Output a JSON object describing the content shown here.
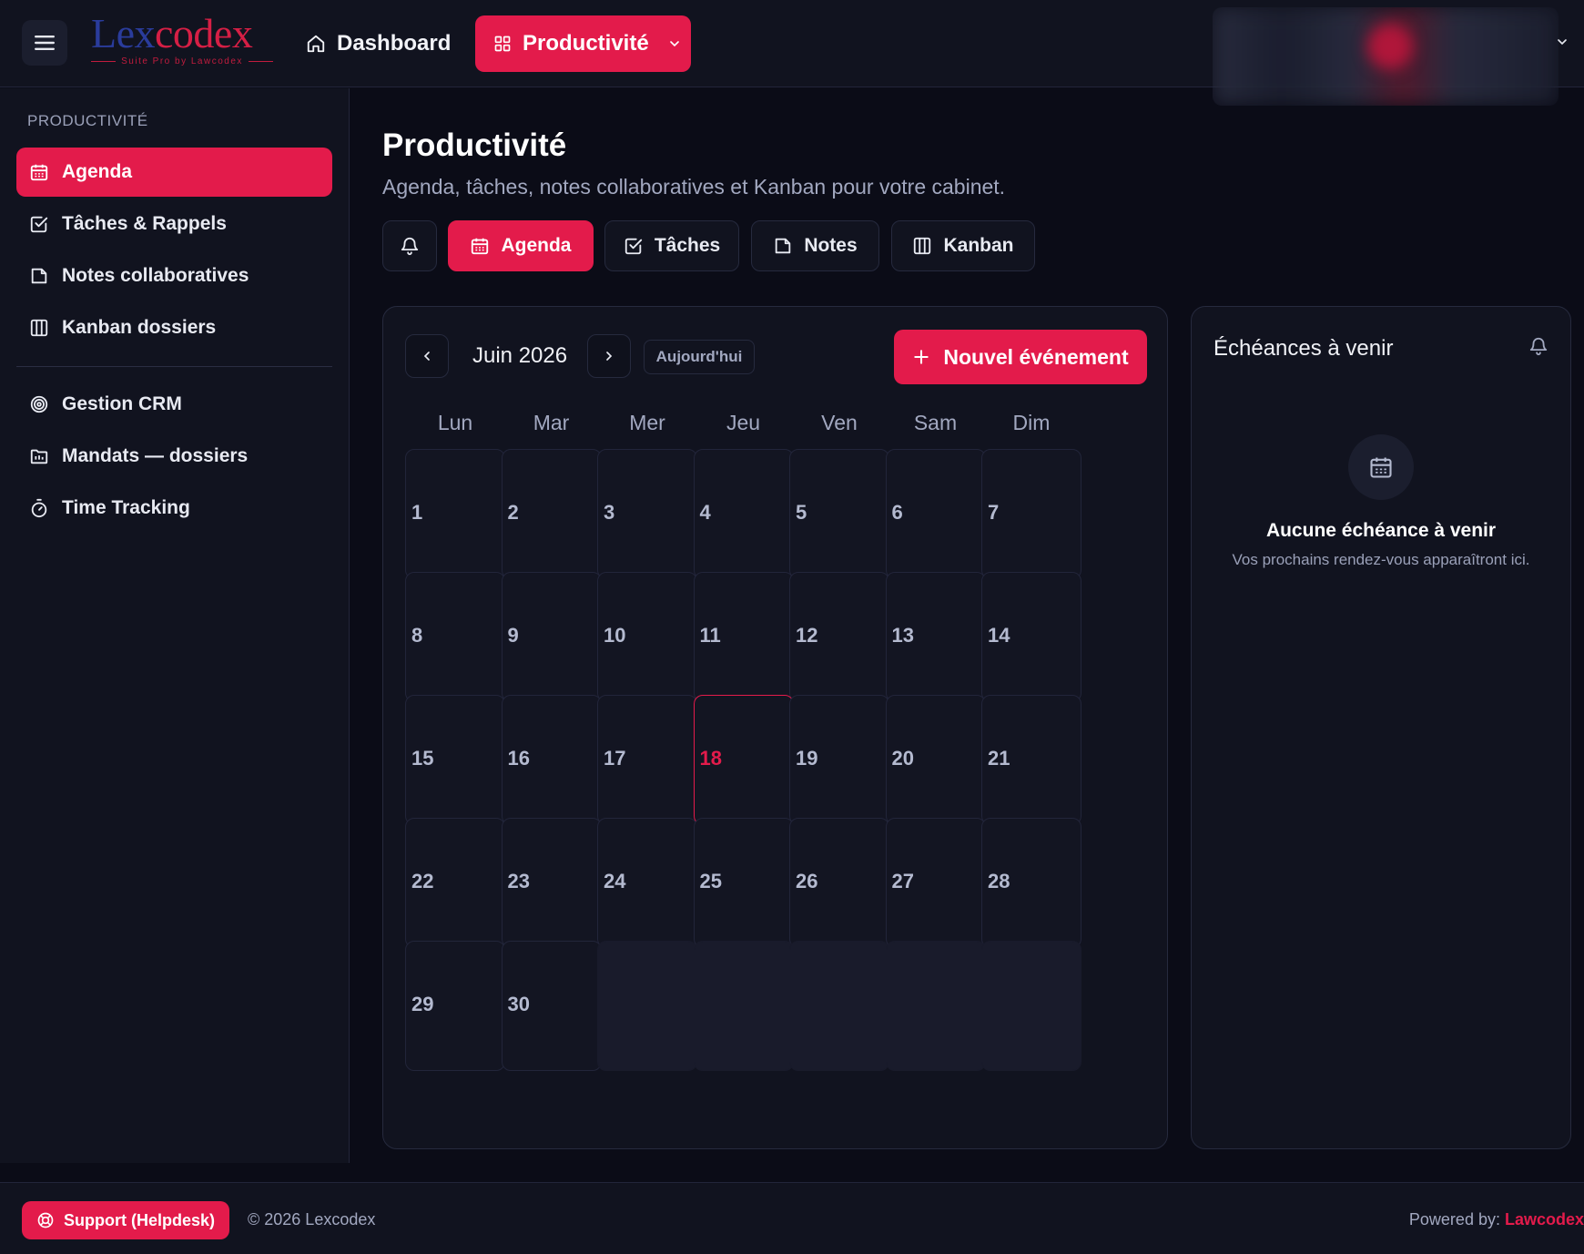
{
  "header": {
    "logo": {
      "text_main": "Lex",
      "text_accent": "codex",
      "tagline": "Suite Pro by Lawcodex"
    },
    "nav": [
      {
        "label": "Dashboard",
        "icon": "home-icon"
      },
      {
        "label": "Productivité",
        "icon": "grid-icon"
      }
    ]
  },
  "sidebar": {
    "section_title": "PRODUCTIVITÉ",
    "items": [
      {
        "label": "Agenda",
        "icon": "calendar-icon",
        "active": true
      },
      {
        "label": "Tâches & Rappels",
        "icon": "checkbox-icon"
      },
      {
        "label": "Notes collaboratives",
        "icon": "note-icon"
      },
      {
        "label": "Kanban dossiers",
        "icon": "columns-icon"
      },
      {
        "label": "Gestion CRM",
        "icon": "target-icon"
      },
      {
        "label": "Mandats — dossiers",
        "icon": "folder-icon"
      },
      {
        "label": "Time Tracking",
        "icon": "stopwatch-icon"
      }
    ]
  },
  "main": {
    "title": "Productivité",
    "subtitle": "Agenda, tâches, notes collaboratives et Kanban pour votre cabinet.",
    "tabs": [
      {
        "label": "Agenda",
        "icon": "calendar-icon",
        "active": true
      },
      {
        "label": "Tâches",
        "icon": "checkbox-icon"
      },
      {
        "label": "Notes",
        "icon": "note-icon"
      },
      {
        "label": "Kanban",
        "icon": "columns-icon"
      }
    ]
  },
  "calendar": {
    "month_label": "Juin 2026",
    "today_label": "Aujourd'hui",
    "new_event_label": "Nouvel événement",
    "weekdays": [
      "Lun",
      "Mar",
      "Mer",
      "Jeu",
      "Ven",
      "Sam",
      "Dim"
    ],
    "days": [
      1,
      2,
      3,
      4,
      5,
      6,
      7,
      8,
      9,
      10,
      11,
      12,
      13,
      14,
      15,
      16,
      17,
      18,
      19,
      20,
      21,
      22,
      23,
      24,
      25,
      26,
      27,
      28,
      29,
      30
    ],
    "today": 18,
    "leading_empty": 0,
    "trailing_empty": 5
  },
  "deadlines": {
    "title": "Échéances à venir",
    "empty_title": "Aucune échéance à venir",
    "empty_subtitle": "Vos prochains rendez-vous apparaîtront ici."
  },
  "footer": {
    "support_label": "Support (Helpdesk)",
    "copyright": "© 2026 Lexcodex",
    "powered_label": "Powered by: ",
    "powered_brand": "Lawcodex"
  },
  "colors": {
    "accent": "#e31b4b",
    "background": "#0b0c17",
    "panel": "#11131f",
    "border": "#262a3e"
  }
}
